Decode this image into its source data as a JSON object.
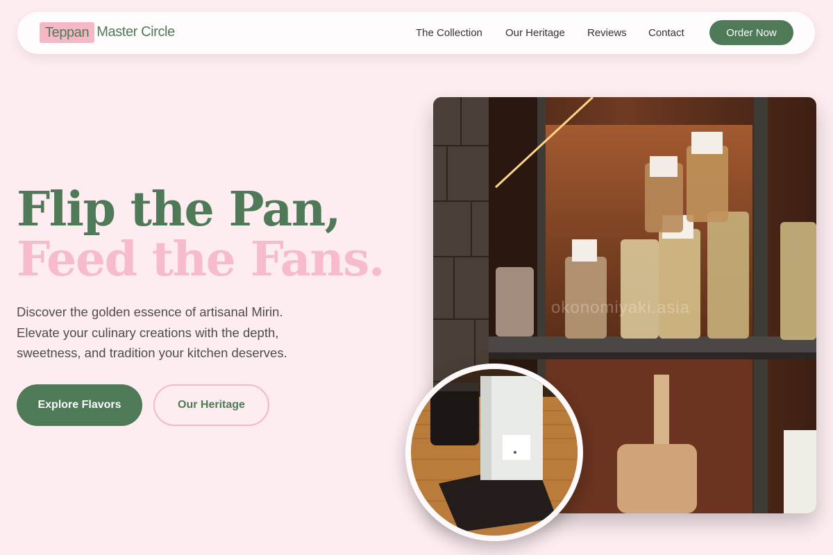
{
  "brand": {
    "highlight": "Teppan",
    "rest": "Master Circle"
  },
  "nav": {
    "links": [
      "The Collection",
      "Our Heritage",
      "Reviews",
      "Contact"
    ],
    "cta": "Order Now"
  },
  "hero": {
    "headline_line1": "Flip the Pan,",
    "headline_line2": "Feed the Fans.",
    "subtext": "Discover the golden essence of artisanal Mirin. Elevate your culinary creations with the depth, sweetness, and tradition your kitchen deserves.",
    "primary_button": "Explore Flavors",
    "secondary_button": "Our Heritage"
  },
  "images": {
    "main_watermark": "okonomiyaki.asia"
  },
  "colors": {
    "background": "#fdedf1",
    "brand_green": "#4e7a58",
    "brand_pink": "#f7bccb"
  }
}
